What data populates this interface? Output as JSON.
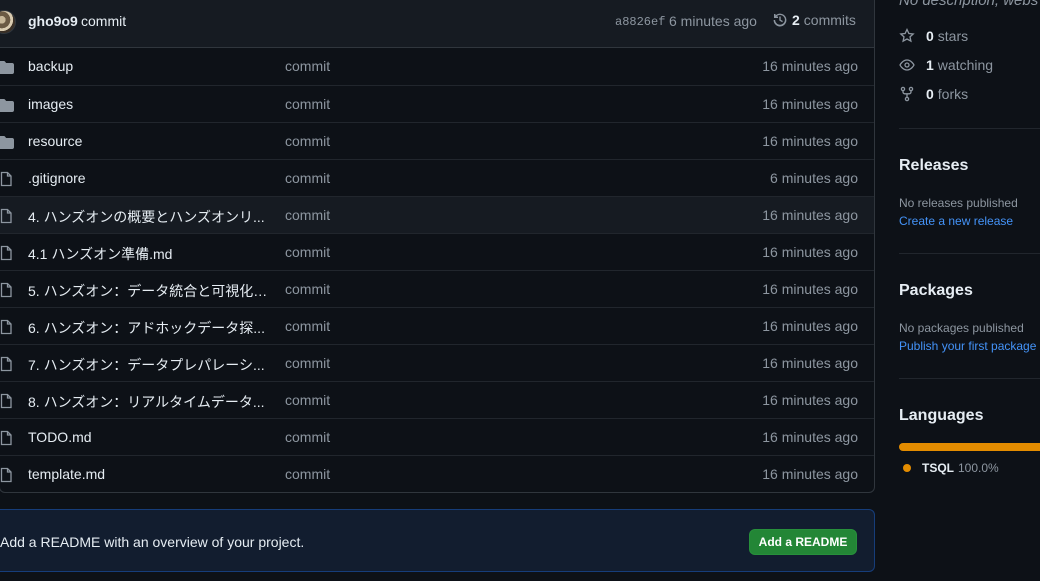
{
  "commit": {
    "author": "gho9o9",
    "message": "commit",
    "sha": "a8826ef",
    "time": "6 minutes ago",
    "commits_count": "2",
    "commits_label": "commits"
  },
  "files": [
    {
      "type": "folder",
      "name": "backup",
      "message": "commit",
      "age": "16 minutes ago"
    },
    {
      "type": "folder",
      "name": "images",
      "message": "commit",
      "age": "16 minutes ago"
    },
    {
      "type": "folder",
      "name": "resource",
      "message": "commit",
      "age": "16 minutes ago"
    },
    {
      "type": "file",
      "name": ".gitignore",
      "message": "commit",
      "age": "6 minutes ago"
    },
    {
      "type": "file",
      "name": "4. ハンズオンの概要とハンズオンリ...",
      "message": "commit",
      "age": "16 minutes ago"
    },
    {
      "type": "file",
      "name": "4.1 ハンズオン準備.md",
      "message": "commit",
      "age": "16 minutes ago"
    },
    {
      "type": "file",
      "name": "5. ハンズオン：データ統合と可視化....",
      "message": "commit",
      "age": "16 minutes ago"
    },
    {
      "type": "file",
      "name": "6. ハンズオン：アドホックデータ探...",
      "message": "commit",
      "age": "16 minutes ago"
    },
    {
      "type": "file",
      "name": "7. ハンズオン：データプレパレーシ...",
      "message": "commit",
      "age": "16 minutes ago"
    },
    {
      "type": "file",
      "name": "8. ハンズオン：リアルタイムデータ...",
      "message": "commit",
      "age": "16 minutes ago"
    },
    {
      "type": "file",
      "name": "TODO.md",
      "message": "commit",
      "age": "16 minutes ago"
    },
    {
      "type": "file",
      "name": "template.md",
      "message": "commit",
      "age": "16 minutes ago"
    }
  ],
  "readme": {
    "text": "Add a README with an overview of your project.",
    "button": "Add a README"
  },
  "sidebar": {
    "description": "No description, webs",
    "stars": {
      "count": "0",
      "label": "stars"
    },
    "watching": {
      "count": "1",
      "label": "watching"
    },
    "forks": {
      "count": "0",
      "label": "forks"
    },
    "releases": {
      "title": "Releases",
      "empty": "No releases published",
      "link": "Create a new release"
    },
    "packages": {
      "title": "Packages",
      "empty": "No packages published",
      "link": "Publish your first package"
    },
    "languages": {
      "title": "Languages",
      "items": [
        {
          "name": "TSQL",
          "percent": "100.0%",
          "color": "#e38c00"
        }
      ]
    }
  },
  "colors": {
    "bg": "#0d1117",
    "accent_link": "#4493f8",
    "button_green": "#238636",
    "tsql": "#e38c00"
  }
}
